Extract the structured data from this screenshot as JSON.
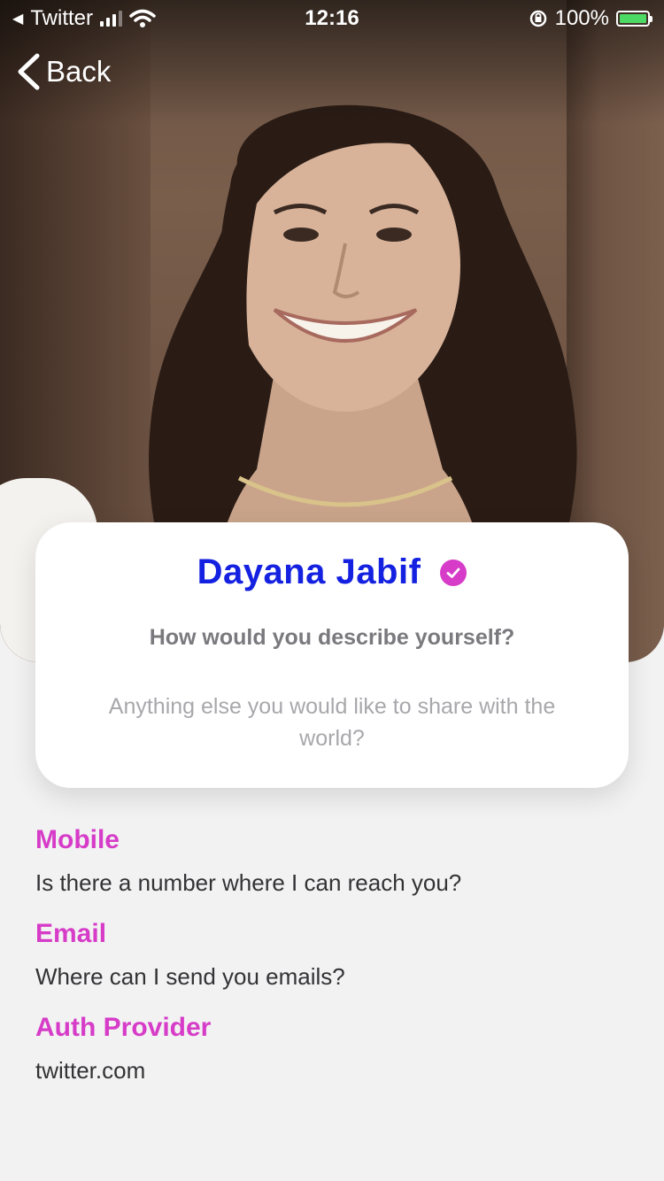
{
  "status_bar": {
    "back_app": "Twitter",
    "time": "12:16",
    "battery_percent": "100%",
    "battery_level": 1.0
  },
  "nav": {
    "back_label": "Back"
  },
  "profile": {
    "name": "Dayana Jabif",
    "verified": true,
    "headline": "How would you describe yourself?",
    "bio": "Anything else you would like to share with the world?"
  },
  "details": {
    "mobile_label": "Mobile",
    "mobile_value": "Is there a number where I can reach you?",
    "email_label": "Email",
    "email_value": "Where can I send you emails?",
    "auth_label": "Auth Provider",
    "auth_value": "twitter.com"
  },
  "colors": {
    "name": "#1421e0",
    "accent": "#d63cc8",
    "background": "#f2f2f2"
  },
  "icons": {
    "back": "chevron-left-icon",
    "verified": "check-circle-icon",
    "wifi": "wifi-icon",
    "signal": "cellular-signal-icon",
    "battery": "battery-charging-icon",
    "orientation_lock": "orientation-lock-icon"
  }
}
